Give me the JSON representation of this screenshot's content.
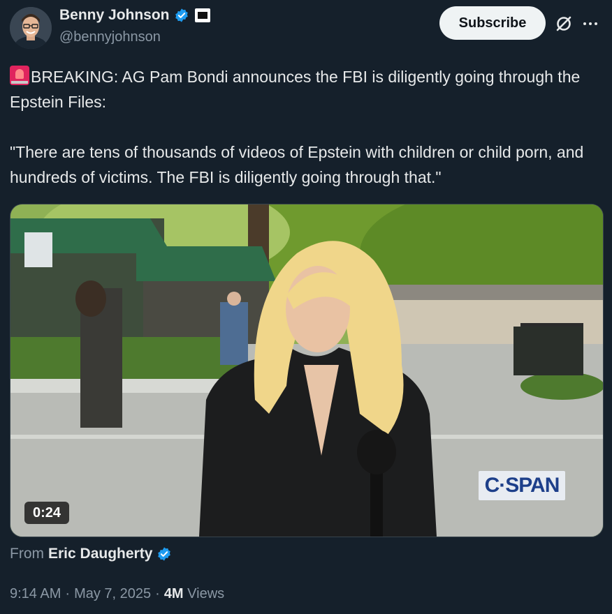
{
  "author": {
    "display_name": "Benny Johnson",
    "handle": "@bennyjohnson"
  },
  "header": {
    "subscribe_label": "Subscribe"
  },
  "tweet": {
    "text": "BREAKING: AG Pam Bondi announces the FBI is diligently going through the Epstein Files:\n\n\"There are tens of thousands of videos of Epstein with children or child porn, and hundreds of victims. The FBI is diligently going through that.\""
  },
  "media": {
    "duration": "0:24",
    "broadcaster_logo": "C·SPAN"
  },
  "source": {
    "label": "From",
    "name": "Eric Daugherty"
  },
  "meta": {
    "time": "9:14 AM",
    "date": "May 7, 2025",
    "views_count": "4M",
    "views_label": "Views"
  },
  "colors": {
    "background": "#15202b",
    "verified": "#1d9bf0",
    "muted_text": "#8b98a5"
  }
}
